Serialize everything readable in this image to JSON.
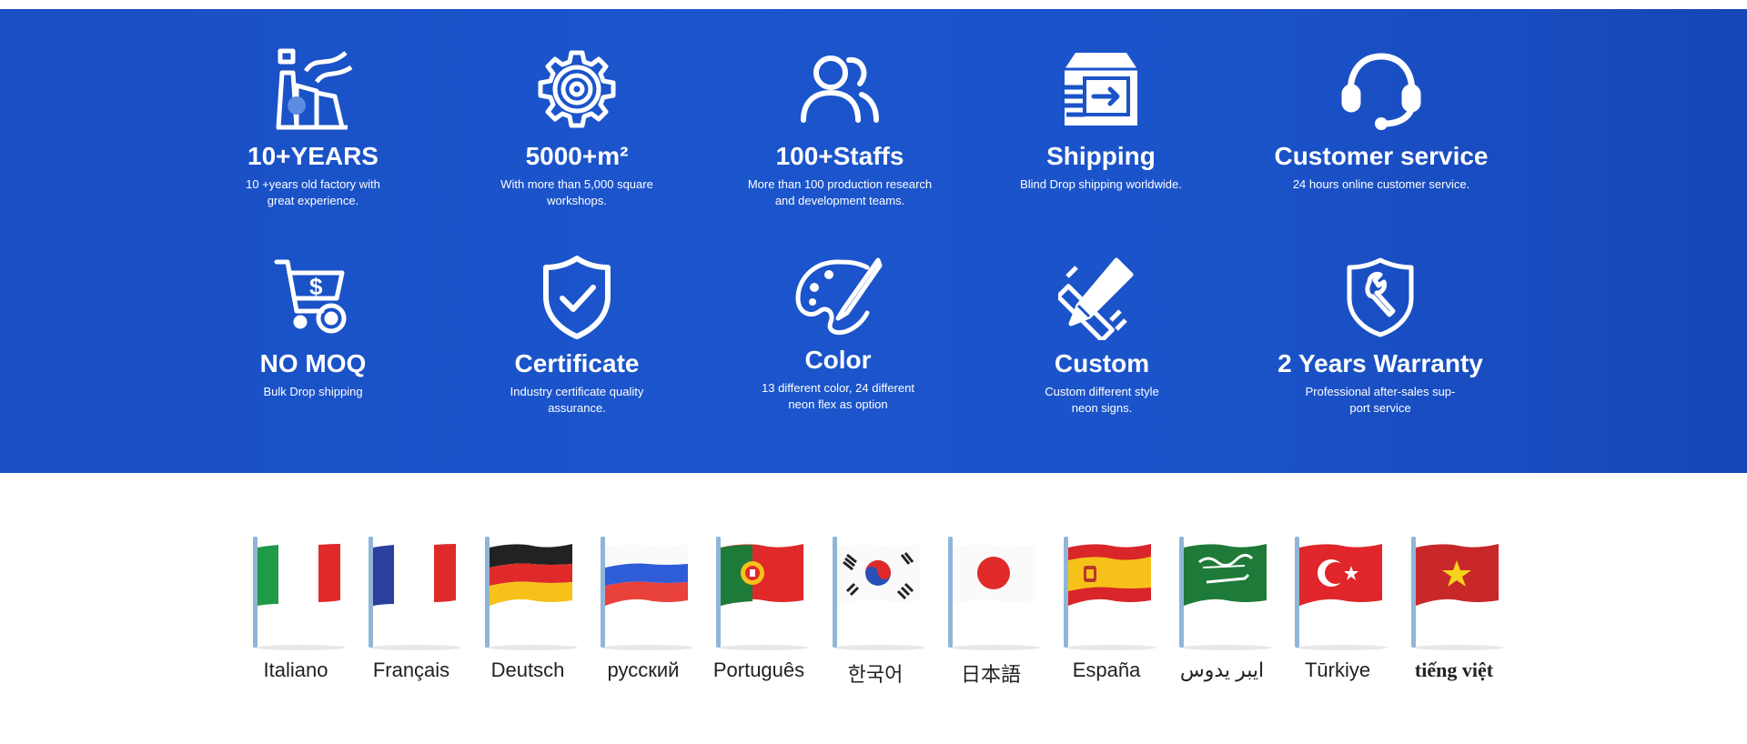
{
  "features": [
    {
      "icon": "factory-icon",
      "title": "10+YEARS",
      "desc": "10 +years old factory with great experience."
    },
    {
      "icon": "gear-icon",
      "title": "5000+m²",
      "desc": "With more than 5,000 square workshops."
    },
    {
      "icon": "users-icon",
      "title": "100+Staffs",
      "desc": "More than 100 production research and development teams."
    },
    {
      "icon": "shipping-box-icon",
      "title": "Shipping",
      "desc": "Blind Drop shipping worldwide."
    },
    {
      "icon": "headset-icon",
      "title": "Customer service",
      "desc": "24 hours online customer service."
    },
    {
      "icon": "cart-dollar-icon",
      "title": "NO MOQ",
      "desc": "Bulk Drop shipping"
    },
    {
      "icon": "shield-check-icon",
      "title": "Certificate",
      "desc": "Industry certificate quality assurance."
    },
    {
      "icon": "palette-icon",
      "title": "Color",
      "desc": "13 different color, 24 different neon flex as option"
    },
    {
      "icon": "pencil-ruler-icon",
      "title": "Custom",
      "desc": "Custom different style neon signs."
    },
    {
      "icon": "shield-wrench-icon",
      "title": "2 Years Warranty",
      "desc": "Professional after-sales sup- port service"
    }
  ],
  "languages": [
    {
      "flag": "italy-flag-icon",
      "label": "Italiano"
    },
    {
      "flag": "france-flag-icon",
      "label": "Français"
    },
    {
      "flag": "germany-flag-icon",
      "label": "Deutsch"
    },
    {
      "flag": "russia-flag-icon",
      "label": "русский"
    },
    {
      "flag": "portugal-flag-icon",
      "label": "Português"
    },
    {
      "flag": "korea-flag-icon",
      "label": "한국어"
    },
    {
      "flag": "japan-flag-icon",
      "label": "日本語"
    },
    {
      "flag": "spain-flag-icon",
      "label": "España"
    },
    {
      "flag": "saudi-arabia-flag-icon",
      "label": "ايبر يدوس"
    },
    {
      "flag": "turkey-flag-icon",
      "label": "Tūrkiye"
    },
    {
      "flag": "vietnam-flag-icon",
      "label": "tiếng việt"
    }
  ],
  "colors": {
    "panel_blue": "#1b53c9",
    "icon_white": "#ffffff"
  }
}
